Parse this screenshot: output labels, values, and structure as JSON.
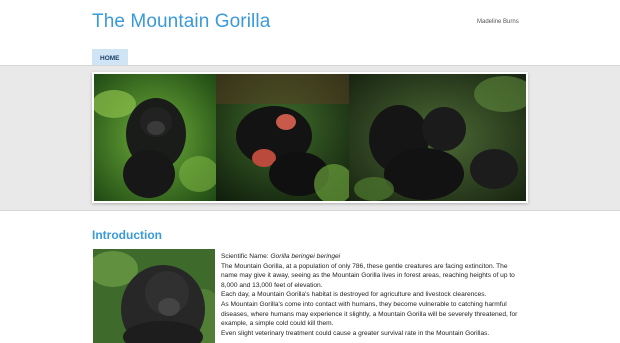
{
  "header": {
    "site_title": "The Mountain Gorilla",
    "author": "Madeline Burns"
  },
  "nav": {
    "home_label": "HOME"
  },
  "main": {
    "section_title": "Introduction",
    "scientific_label": "Scientific Name: ",
    "scientific_name": "Gorilla beringei beringei",
    "paragraphs": [
      "The Mountain Gorilla, at a population of only 786, these gentle creatures are facing extinciton. The name may give it away, seeing as the Mountain Gorilla lives in forest areas, reaching heights of up to 8,000 and 13,000 feet of elevation.",
      "Each day, a Mountain Gorilla's habitat is destroyed for agriculture and livestock clearences.",
      "As Mountain Gorilla's come into contact with humans, they become vulnerable to catching harmful diseases, where humans may experience it slightly, a Mountain Gorilla will be severely threatened, for example, a simple cold could kill them.",
      "Even slight veterinary treatment could cause a greater survival rate in the Mountain Gorillas."
    ]
  },
  "colors": {
    "accent": "#3a9ad9",
    "nav_active_bg": "#cfe5f6",
    "banner_band": "#e9e9e9"
  }
}
